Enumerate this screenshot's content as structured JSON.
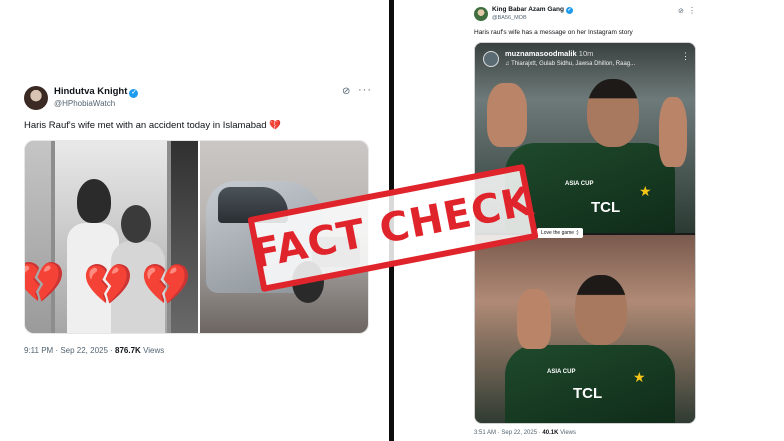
{
  "left_tweet": {
    "display_name": "Hindutva Knight",
    "handle": "@HPhobiaWatch",
    "text": "Haris Rauf's wife met with an accident today in Islamabad",
    "text_emoji": "💔",
    "time": "9:11 PM",
    "date": "Sep 22, 2025",
    "views_count": "876.7K",
    "views_label": "Views",
    "grok_icon": "grok-icon",
    "more_icon": "more-icon",
    "media_hearts": [
      "💔",
      "💔",
      "💔"
    ]
  },
  "right_tweet": {
    "display_name": "King Babar Azam Gang",
    "handle": "@BA56_MOB",
    "text": "Haris rauf's wife has a message on her Instagram story",
    "time": "3:51 AM",
    "date": "Sep 22, 2025",
    "views_count": "40.1K",
    "views_label": "Views",
    "story": {
      "username": "muznamasoodmalik",
      "age": "10m",
      "tags": "Thiarajxtt, Gulab Sidhu, Jawsa Dhillon, Raag...",
      "sponsor_top": "TCL",
      "sponsor_bottom": "TCL",
      "cup_label": "ASIA CUP",
      "caption_chip": "Love the game :)"
    }
  },
  "stamp": {
    "text": "FACT CHECK",
    "color": "#e0242b"
  },
  "colors": {
    "verified": "#1d9bf0",
    "secondary_text": "#536471",
    "heart": "#e21a1a"
  }
}
